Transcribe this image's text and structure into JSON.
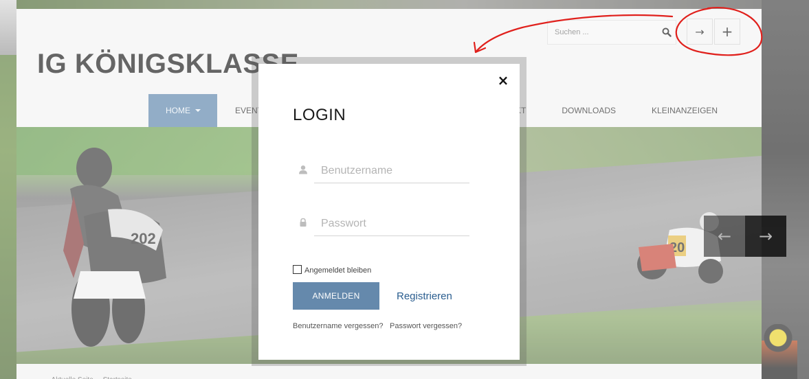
{
  "site": {
    "brand": "IG KÖNIGSKLASSE",
    "search_placeholder": "Suchen ...",
    "header_buttons": {
      "login_glyph": "→",
      "register_glyph": "+"
    },
    "nav": {
      "home": "HOME",
      "events": "EVENTS",
      "kontakt": "AKT",
      "downloads": "DOWNLOADS",
      "kleinanzeigen": "KLEINANZEIGEN"
    },
    "slider": {
      "prev_glyph": "←",
      "next_glyph": "→"
    },
    "breadcrumb": "... Aktuelle Seite ... Startseite"
  },
  "modal": {
    "title": "LOGIN",
    "close_glyph": "×",
    "username_placeholder": "Benutzername",
    "password_placeholder": "Passwort",
    "remember_label": "Angemeldet bleiben",
    "submit_label": "ANMELDEN",
    "register_link": "Registrieren",
    "forgot_username": "Benutzername vergessen?",
    "forgot_password": "Passwort vergessen?"
  },
  "colors": {
    "accent_blue": "#6589ac",
    "nav_active": "#5f87ad",
    "link_blue": "#2a5d8f",
    "annotation_red": "#e0201c"
  },
  "icons": [
    "search-icon",
    "login-arrow-icon",
    "plus-icon",
    "user-icon",
    "lock-icon",
    "close-icon",
    "arrow-left-icon",
    "arrow-right-icon"
  ]
}
